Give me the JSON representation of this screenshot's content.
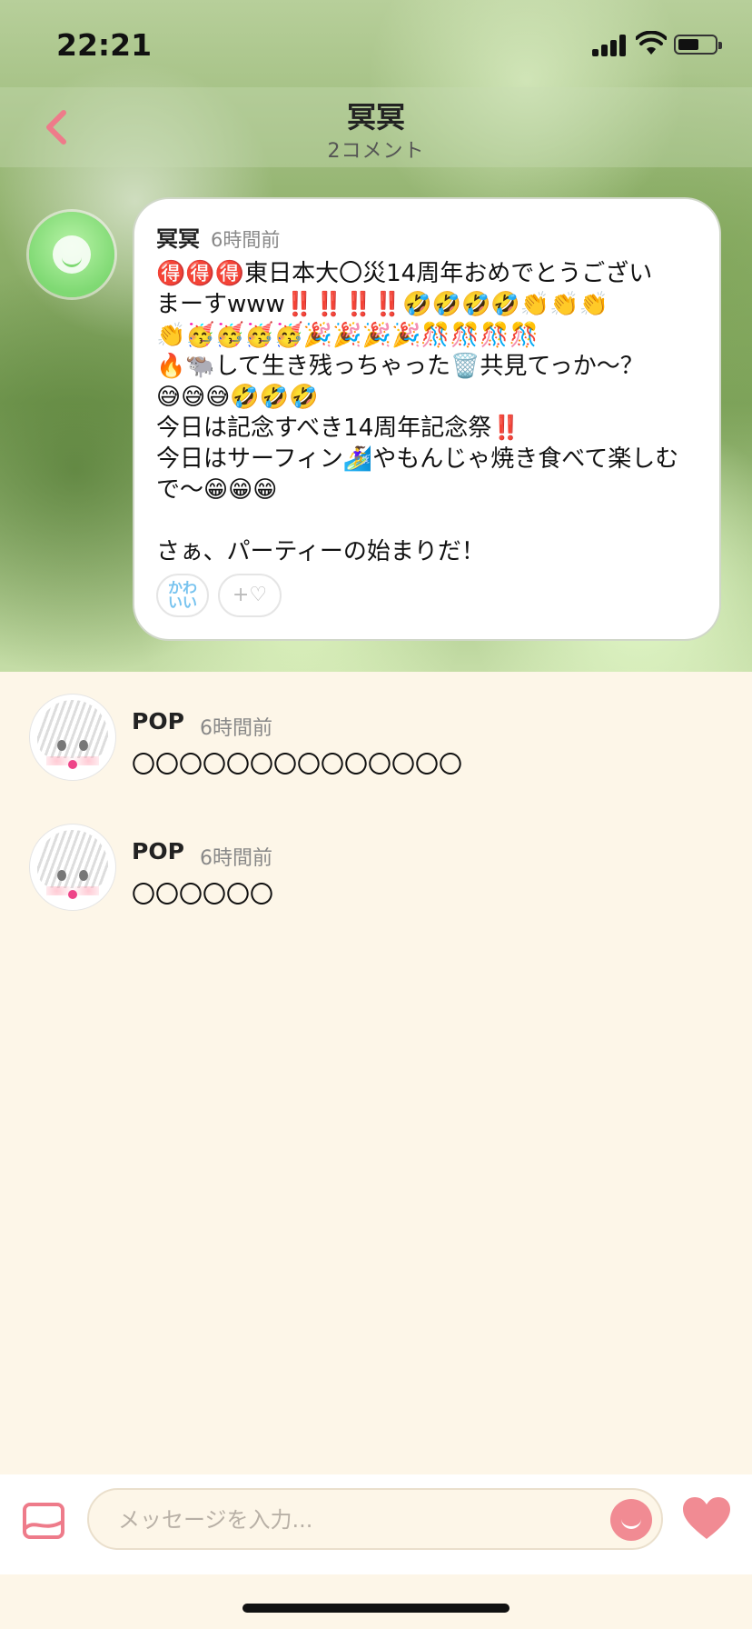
{
  "status": {
    "time": "22:21"
  },
  "nav": {
    "title": "冥冥",
    "subtitle": "2コメント"
  },
  "post": {
    "author": "冥冥",
    "time": "6時間前",
    "body": "🉐🉐🉐東日本大〇災14周年おめでとうござい\nまーすwww‼️‼️‼️‼️🤣🤣🤣🤣👏👏👏\n👏🥳🥳🥳🥳🎉🎉🎉🎉🎊🎊🎊🎊\n🔥🐃して生き残っちゃった🗑️共見てっか〜？\n😅😅😅🤣🤣🤣\n今日は記念すべき14周年記念祭‼️\n今日はサーフィン🏄‍♀️やもんじゃ焼き食べて楽しむ\nで〜😁😁😁\n\nさぁ、パーティーの始まりだ！",
    "reactions": {
      "kawaii": "かわ\nいい",
      "add": "+♡"
    }
  },
  "comments": [
    {
      "author": "POP",
      "time": "6時間前",
      "text": "〇〇〇〇〇〇〇〇〇〇〇〇〇〇"
    },
    {
      "author": "POP",
      "time": "6時間前",
      "text": "〇〇〇〇〇〇"
    }
  ],
  "composer": {
    "placeholder": "メッセージを入力..."
  },
  "colors": {
    "accent": "#f18b93",
    "background": "#fdf6e8",
    "kawaii": "#77c3ef"
  },
  "icons": [
    "back-chevron-icon",
    "image-icon",
    "smile-stamp-icon",
    "heart-icon",
    "signal-icon",
    "wifi-icon",
    "battery-icon"
  ]
}
